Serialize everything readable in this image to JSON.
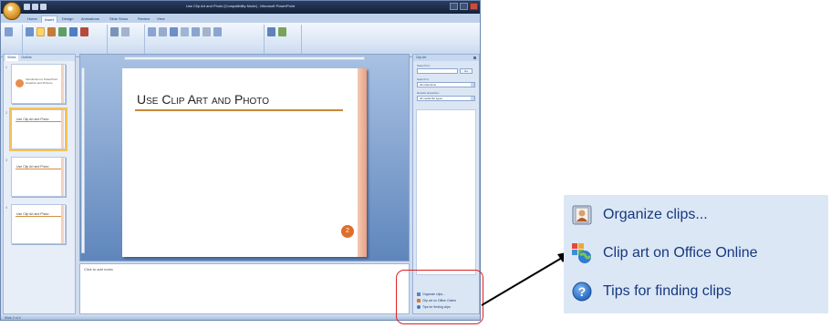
{
  "window": {
    "title": "Use Clip Art and Photo [Compatibility Mode] - Microsoft PowerPoint",
    "tabs": [
      "Home",
      "Insert",
      "Design",
      "Animations",
      "Slide Show",
      "Review",
      "View"
    ]
  },
  "left_pane": {
    "tabs": [
      "Slides",
      "Outline"
    ],
    "thumbnails": [
      {
        "number": "1",
        "text": "Introduction to PowerPoint Graphics and Pictures"
      },
      {
        "number": "2",
        "title": "Use Clip Art and Photo"
      },
      {
        "number": "3",
        "title": "Use Clip Art and Photo"
      },
      {
        "number": "4",
        "title": "Use Clip Art and Photo"
      }
    ]
  },
  "slide": {
    "title": "Use Clip Art and Photo",
    "number_badge": "2"
  },
  "notes": {
    "placeholder": "Click to add notes"
  },
  "clip_pane": {
    "header": "Clip Art",
    "search_label": "Search for:",
    "go_label": "Go",
    "search_in_label": "Search in:",
    "search_in_value": "All collections",
    "results_label": "Results should be:",
    "results_value": "All media file types",
    "links": [
      "Organize clips...",
      "Clip art on Office Online",
      "Tips for finding clips"
    ]
  },
  "status_bar": {
    "text": "Slide 2 of 4"
  },
  "callout": {
    "items": [
      {
        "label": "Organize clips...",
        "icon": "organize-clips-icon"
      },
      {
        "label": "Clip art on Office Online",
        "icon": "office-online-icon"
      },
      {
        "label": "Tips for finding clips",
        "icon": "help-icon"
      }
    ]
  },
  "colors": {
    "highlight_box": "#e02020",
    "link_text": "#15387d",
    "callout_background": "#dce7f6"
  }
}
